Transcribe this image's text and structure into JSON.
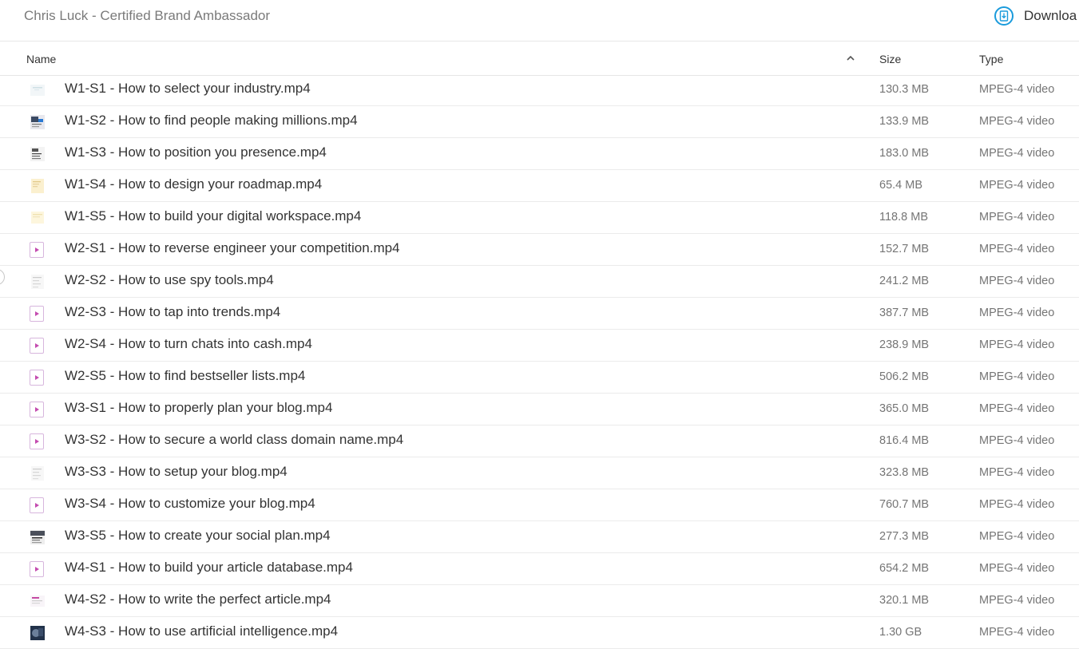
{
  "header": {
    "title": "Chris Luck - Certified Brand Ambassador",
    "download_label": "Downloa",
    "download_icon": "download-icon"
  },
  "columns": {
    "name": "Name",
    "size": "Size",
    "type": "Type"
  },
  "sort_icon": "chevron-up-icon",
  "files": [
    {
      "name": "W1-S1 - How to select your industry.mp4",
      "size": "130.3 MB",
      "type": "MPEG-4 video",
      "thumb": "doc-light"
    },
    {
      "name": "W1-S2 - How to find people making millions.mp4",
      "size": "133.9 MB",
      "type": "MPEG-4 video",
      "thumb": "screen-blue"
    },
    {
      "name": "W1-S3 - How to position you presence.mp4",
      "size": "183.0 MB",
      "type": "MPEG-4 video",
      "thumb": "screen-dark"
    },
    {
      "name": "W1-S4 - How to design your roadmap.mp4",
      "size": "65.4 MB",
      "type": "MPEG-4 video",
      "thumb": "doc-yellow"
    },
    {
      "name": "W1-S5 - How to build your digital workspace.mp4",
      "size": "118.8 MB",
      "type": "MPEG-4 video",
      "thumb": "doc-yellow-light"
    },
    {
      "name": "W2-S1 - How to reverse engineer your competition.mp4",
      "size": "152.7 MB",
      "type": "MPEG-4 video",
      "thumb": "video"
    },
    {
      "name": "W2-S2 - How to use spy tools.mp4",
      "size": "241.2 MB",
      "type": "MPEG-4 video",
      "thumb": "doc-gray"
    },
    {
      "name": "W2-S3 - How to tap into trends.mp4",
      "size": "387.7 MB",
      "type": "MPEG-4 video",
      "thumb": "video"
    },
    {
      "name": "W2-S4 - How to turn chats into cash.mp4",
      "size": "238.9 MB",
      "type": "MPEG-4 video",
      "thumb": "video"
    },
    {
      "name": "W2-S5 - How to find bestseller lists.mp4",
      "size": "506.2 MB",
      "type": "MPEG-4 video",
      "thumb": "video"
    },
    {
      "name": "W3-S1 - How to properly plan your blog.mp4",
      "size": "365.0 MB",
      "type": "MPEG-4 video",
      "thumb": "video"
    },
    {
      "name": "W3-S2 - How to secure a world class domain name.mp4",
      "size": "816.4 MB",
      "type": "MPEG-4 video",
      "thumb": "video"
    },
    {
      "name": "W3-S3 - How to setup your blog.mp4",
      "size": "323.8 MB",
      "type": "MPEG-4 video",
      "thumb": "doc-gray"
    },
    {
      "name": "W3-S4 - How to customize your blog.mp4",
      "size": "760.7 MB",
      "type": "MPEG-4 video",
      "thumb": "video"
    },
    {
      "name": "W3-S5 - How to create your social plan.mp4",
      "size": "277.3 MB",
      "type": "MPEG-4 video",
      "thumb": "screen-photo"
    },
    {
      "name": "W4-S1 - How to build your article database.mp4",
      "size": "654.2 MB",
      "type": "MPEG-4 video",
      "thumb": "video"
    },
    {
      "name": "W4-S2 - How to write the perfect article.mp4",
      "size": "320.1 MB",
      "type": "MPEG-4 video",
      "thumb": "doc-pink"
    },
    {
      "name": "W4-S3 - How to use artificial intelligence.mp4",
      "size": "1.30 GB",
      "type": "MPEG-4 video",
      "thumb": "photo-dark"
    }
  ]
}
